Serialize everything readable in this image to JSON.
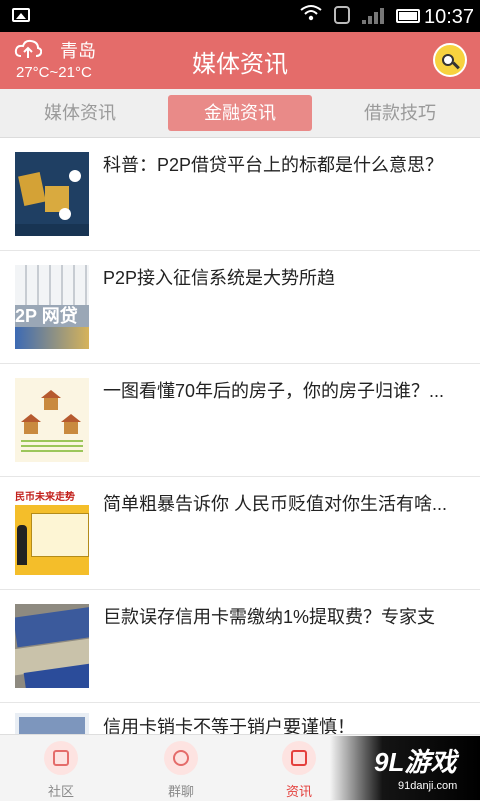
{
  "status_bar": {
    "time": "10:37",
    "icons": [
      "photo-icon",
      "wifi-icon",
      "sim-icon",
      "signal-icon",
      "battery-icon"
    ]
  },
  "header": {
    "city": "青岛",
    "temperature": "27°C~21°C",
    "title": "媒体资讯",
    "weather_icon": "cloud-upload-icon",
    "avatar_icon": "search-face-icon"
  },
  "tabs": [
    {
      "label": "媒体资讯",
      "active": false
    },
    {
      "label": "金融资讯",
      "active": true
    },
    {
      "label": "借款技巧",
      "active": false
    }
  ],
  "articles": [
    {
      "title": "科普：P2P借贷平台上的标都是什么意思？"
    },
    {
      "title": "P2P接入征信系统是大势所趋",
      "thumb_text": "2P 网贷"
    },
    {
      "title": "一图看懂70年后的房子，你的房子归谁？..."
    },
    {
      "title": "简单粗暴告诉你 人民币贬值对你生活有啥...",
      "thumb_text": "民币未来走势"
    },
    {
      "title": "巨款误存信用卡需缴纳1%提取费？专家支"
    },
    {
      "title": "信用卡销卡不等于销户要谨慎！"
    }
  ],
  "bottom_nav": [
    {
      "label": "社区",
      "icon": "edit-icon",
      "active": false
    },
    {
      "label": "群聊",
      "icon": "group-icon",
      "active": false
    },
    {
      "label": "资讯",
      "icon": "chat-icon",
      "active": true
    }
  ],
  "watermark": {
    "brand": "9L游戏",
    "url": "91danji.com"
  },
  "colors": {
    "header": "#e46c6a",
    "active_tab": "#e98a88",
    "active_nav": "#e4403d"
  }
}
